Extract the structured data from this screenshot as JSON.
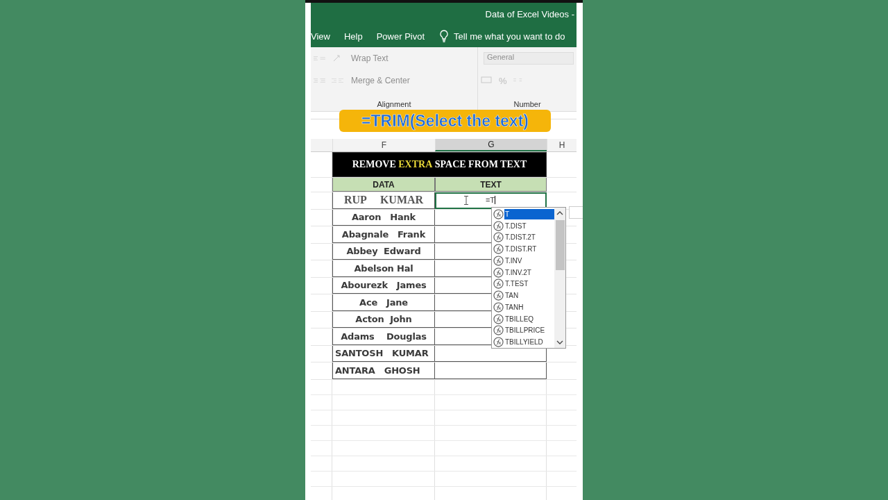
{
  "window": {
    "title": "Data of Excel Videos -"
  },
  "ribbon_tabs": [
    {
      "label": "View"
    },
    {
      "label": "Help"
    },
    {
      "label": "Power Pivot"
    }
  ],
  "tell_me": {
    "placeholder": "Tell me what you want to do"
  },
  "ribbon": {
    "alignment": {
      "label": "Alignment",
      "controls": [
        {
          "label": "Wrap Text",
          "disabled": true
        },
        {
          "label": "Merge & Center",
          "disabled": true
        }
      ]
    },
    "number": {
      "label": "Number",
      "format_box": {
        "value": "General",
        "disabled": true
      },
      "percent": "%"
    }
  },
  "caption": "=TRIM(Select the text)",
  "sheet": {
    "columns": [
      {
        "label": "F",
        "selected": false
      },
      {
        "label": "G",
        "selected": true
      },
      {
        "label": "H",
        "selected": false
      }
    ],
    "title": "REMOVE **EXTRA** SPACE FROM TEXT",
    "headers": [
      "DATA",
      "TEXT"
    ],
    "rows": [
      {
        "data": "RUP     KUMAR",
        "kind": "serif",
        "left_aligned": false,
        "editing": true,
        "text": "=T"
      },
      {
        "data": "Aaron   Hank",
        "kind": "sans",
        "left_aligned": false,
        "editing": false
      },
      {
        "data": "Abagnale   Frank",
        "kind": "sans",
        "left_aligned": false,
        "editing": false
      },
      {
        "data": "Abbey  Edward",
        "kind": "sans",
        "left_aligned": false,
        "editing": false
      },
      {
        "data": "Abelson Hal",
        "kind": "sans",
        "left_aligned": false,
        "editing": false
      },
      {
        "data": "Abourezk   James",
        "kind": "sans",
        "left_aligned": false,
        "editing": false
      },
      {
        "data": "Ace   Jane",
        "kind": "sans",
        "left_aligned": false,
        "editing": false
      },
      {
        "data": "Acton  John",
        "kind": "sans",
        "left_aligned": false,
        "editing": false
      },
      {
        "data": "Adams    Douglas",
        "kind": "sans",
        "left_aligned": false,
        "editing": false
      },
      {
        "data": "SANTOSH   KUMAR",
        "kind": "sans",
        "left_aligned": true,
        "editing": false
      },
      {
        "data": "ANTARA   GHOSH",
        "kind": "sans",
        "left_aligned": true,
        "editing": false
      }
    ],
    "autocomplete": {
      "items": [
        {
          "label": "T",
          "selected": true
        },
        {
          "label": "T.DIST",
          "selected": false
        },
        {
          "label": "T.DIST.2T",
          "selected": false
        },
        {
          "label": "T.DIST.RT",
          "selected": false
        },
        {
          "label": "T.INV",
          "selected": false
        },
        {
          "label": "T.INV.2T",
          "selected": false
        },
        {
          "label": "T.TEST",
          "selected": false
        },
        {
          "label": "TAN",
          "selected": false
        },
        {
          "label": "TANH",
          "selected": false
        },
        {
          "label": "TBILLEQ",
          "selected": false
        },
        {
          "label": "TBILLPRICE",
          "selected": false
        },
        {
          "label": "TBILLYIELD",
          "selected": false
        }
      ]
    }
  }
}
